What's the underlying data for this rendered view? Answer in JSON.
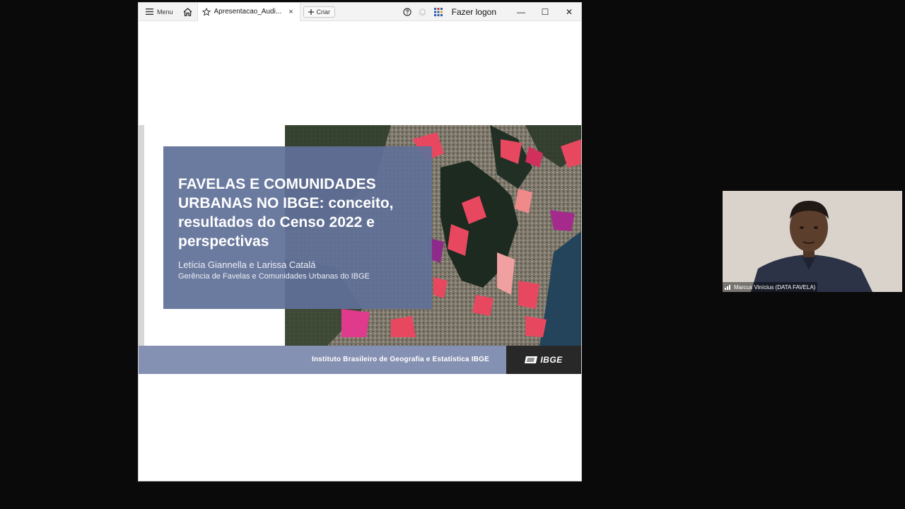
{
  "titlebar": {
    "menu_label": "Menu",
    "tab_title": "Apresentacao_Audi...",
    "tab_close": "×",
    "create_label": "Criar",
    "logon_label": "Fazer logon",
    "minimize": "—",
    "maximize": "☐",
    "close": "✕"
  },
  "slide": {
    "title": "FAVELAS E COMUNIDADES URBANAS NO IBGE: conceito, resultados do Censo 2022 e perspectivas",
    "authors": "Letícia Giannella e Larissa Catalá",
    "department": "Gerência de Favelas e Comunidades Urbanas do IBGE",
    "footer_text": "Instituto Brasileiro de Geografia e Estatística  IBGE",
    "logo_text": "IBGE"
  },
  "video": {
    "participant_name": "Marcus Vinícius (DATA FAVELA)"
  },
  "colors": {
    "title_box": "#6070a0",
    "footer_bar": "#8591b2",
    "favela_highlight": "#e8485f"
  }
}
